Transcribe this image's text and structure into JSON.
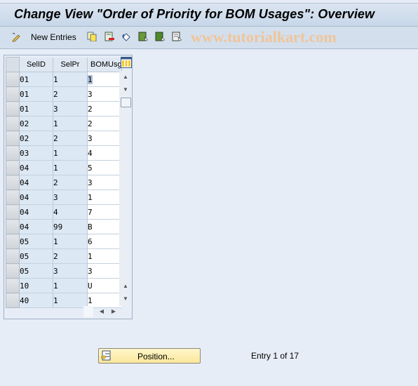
{
  "window": {
    "title": "Change View \"Order of Priority for BOM Usages\": Overview"
  },
  "toolbar": {
    "new_entries_label": "New Entries",
    "icons": [
      "display-change-icon",
      "copy-as-icon",
      "delete-icon",
      "undo-change-icon",
      "select-all-icon",
      "select-block-icon",
      "deselect-all-icon"
    ],
    "watermark": "www.tutorialkart.com"
  },
  "table": {
    "columns": [
      "SelID",
      "SelPr",
      "BOMUsg"
    ],
    "rows": [
      [
        "01",
        "1",
        "1"
      ],
      [
        "01",
        "2",
        "3"
      ],
      [
        "01",
        "3",
        "2"
      ],
      [
        "02",
        "1",
        "2"
      ],
      [
        "02",
        "2",
        "3"
      ],
      [
        "03",
        "1",
        "4"
      ],
      [
        "04",
        "1",
        "5"
      ],
      [
        "04",
        "2",
        "3"
      ],
      [
        "04",
        "3",
        "1"
      ],
      [
        "04",
        "4",
        "7"
      ],
      [
        "04",
        "99",
        "B"
      ],
      [
        "05",
        "1",
        "6"
      ],
      [
        "05",
        "2",
        "1"
      ],
      [
        "05",
        "3",
        "3"
      ],
      [
        "10",
        "1",
        "U"
      ],
      [
        "40",
        "1",
        "1"
      ]
    ]
  },
  "footer": {
    "position_button_label": "Position...",
    "entry_status": "Entry 1 of 17"
  }
}
